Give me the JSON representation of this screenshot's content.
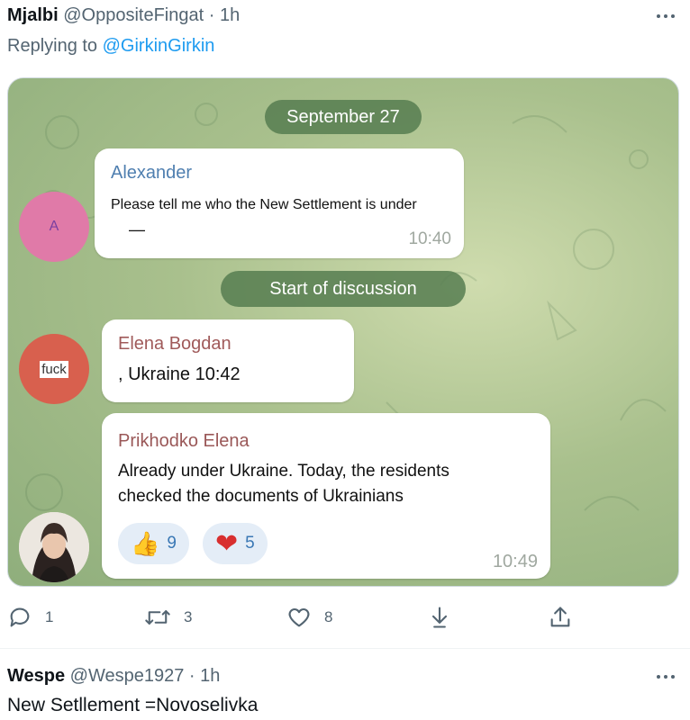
{
  "tweet1": {
    "name": "Mjalbi",
    "handle": "@OppositeFingat",
    "separator": "·",
    "time": "1h",
    "replying_prefix": "Replying to",
    "replying_to": "@GirkinGirkin",
    "more_icon": "more-horizontal-icon"
  },
  "media": {
    "date_pill": "September 27",
    "discussion_pill": "Start of discussion",
    "messages": [
      {
        "sender": "Alexander",
        "sender_color": "#4f7fb0",
        "text": "Please tell me who the New Settlement is under",
        "text2": "—",
        "time": "10:40",
        "avatar_letter": "A",
        "avatar_color": "#e07aa8"
      },
      {
        "sender": "Elena Bogdan",
        "sender_color": "#a05a5a",
        "text": ", Ukraine",
        "time": "10:42",
        "avatar_label": "fuck",
        "avatar_color": "#d8604e"
      },
      {
        "sender": "Prikhodko Elena",
        "sender_color": "#9a5858",
        "text_line1": "Already under Ukraine. Today, the residents",
        "text_line2": "checked the documents of Ukrainians",
        "time": "10:49",
        "reactions": [
          {
            "icon": "thumbs-up-icon",
            "emoji": "👍",
            "count": "9"
          },
          {
            "icon": "heart-icon",
            "emoji": "❤",
            "count": "5"
          }
        ]
      }
    ]
  },
  "actions": {
    "reply_count": "1",
    "retweet_count": "3",
    "like_count": "8"
  },
  "tweet2": {
    "name": "Wespe",
    "handle": "@Wespe1927",
    "separator": "·",
    "time": "1h",
    "text": "New Setllement =Novoselivka"
  }
}
